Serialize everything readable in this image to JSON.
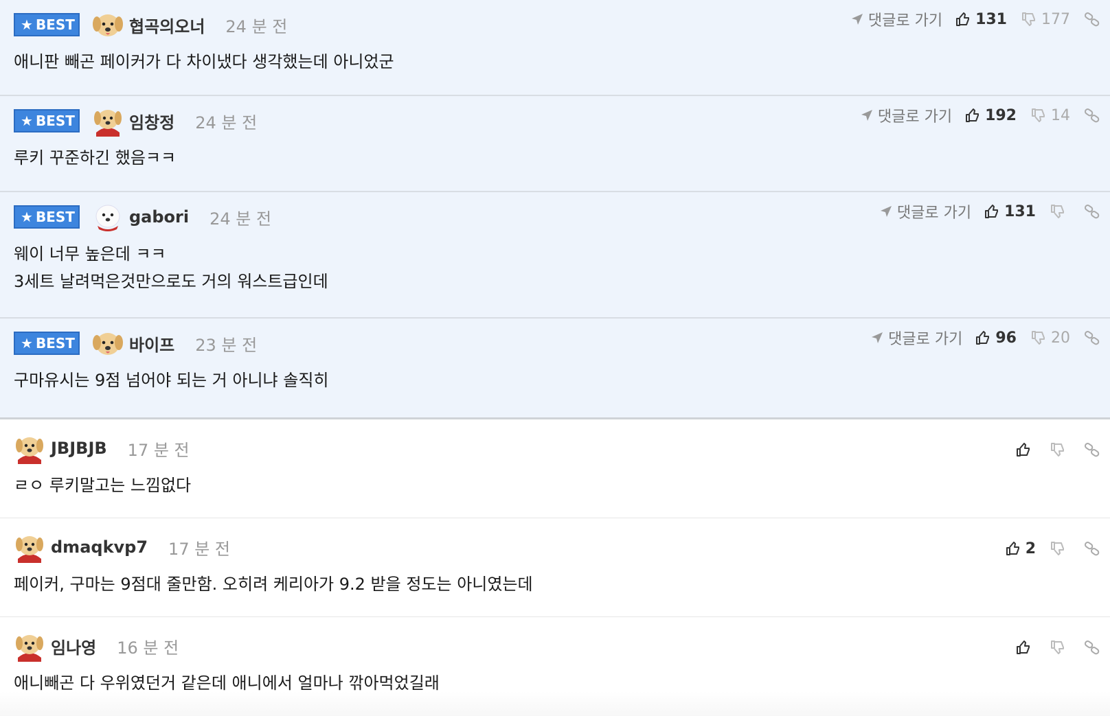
{
  "labels": {
    "best": "BEST",
    "go_reply": "댓글로 가기"
  },
  "best_comments": [
    {
      "nick": "협곡의오너",
      "time": "24 분 전",
      "lines": [
        "애니판 빼곤 페이커가 다 차이냈다 생각했는데 아니었군"
      ],
      "up": "131",
      "down": "177",
      "avatar": "puppy"
    },
    {
      "nick": "임창정",
      "time": "24 분 전",
      "lines": [
        "루키 꾸준하긴 했음ㅋㅋ"
      ],
      "up": "192",
      "down": "14",
      "avatar": "puppy-red-cape"
    },
    {
      "nick": "gabori",
      "time": "24 분 전",
      "lines": [
        "웨이 너무 높은데 ㅋㅋ",
        "3세트 날려먹은것만으로도 거의 워스트급인데"
      ],
      "up": "131",
      "down": "",
      "avatar": "white-dog-red-scarf"
    },
    {
      "nick": "바이프",
      "time": "23 분 전",
      "lines": [
        "구마유시는 9점 넘어야 되는 거 아니냐 솔직히"
      ],
      "up": "96",
      "down": "20",
      "avatar": "puppy"
    }
  ],
  "comments": [
    {
      "nick": "JBJBJB",
      "time": "17 분 전",
      "lines": [
        "ㄹㅇ 루키말고는 느낌없다"
      ],
      "up": "",
      "down": "",
      "avatar": "puppy-red-cape"
    },
    {
      "nick": "dmaqkvp7",
      "time": "17 분 전",
      "lines": [
        "페이커, 구마는 9점대 줄만함. 오히려 케리아가 9.2 받을 정도는 아니였는데"
      ],
      "up": "2",
      "down": "",
      "avatar": "puppy-red-cape"
    },
    {
      "nick": "임나영",
      "time": "16 분 전",
      "lines": [
        "애니빼곤 다 우위였던거 같은데 애니에서 얼마나 깎아먹었길래"
      ],
      "up": "",
      "down": "",
      "avatar": "puppy-red-cape"
    }
  ],
  "colors": {
    "best_badge": "#3d85de",
    "best_bg": "#eef4fc",
    "muted": "#999999"
  }
}
